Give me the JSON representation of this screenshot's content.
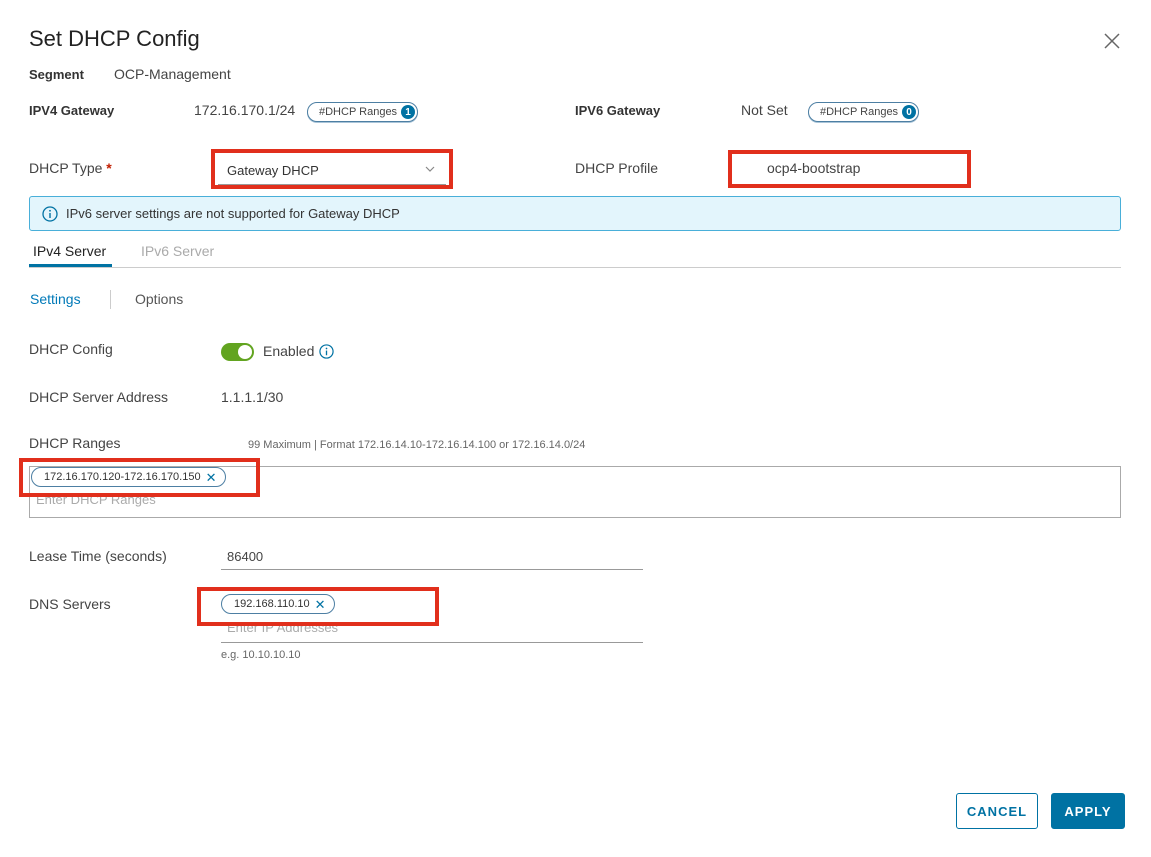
{
  "dialog": {
    "title": "Set DHCP Config"
  },
  "segment": {
    "label": "Segment",
    "value": "OCP-Management"
  },
  "ipv4_gateway": {
    "label": "IPV4 Gateway",
    "value": "172.16.170.1/24",
    "ranges_label": "#DHCP Ranges",
    "ranges_count": "1"
  },
  "ipv6_gateway": {
    "label": "IPV6 Gateway",
    "value": "Not Set",
    "ranges_label": "#DHCP Ranges",
    "ranges_count": "0"
  },
  "dhcp_type": {
    "label": "DHCP Type",
    "required_mark": "*",
    "value": "Gateway DHCP"
  },
  "dhcp_profile": {
    "label": "DHCP Profile",
    "value": "ocp4-bootstrap"
  },
  "alert": {
    "text": "IPv6 server settings are not supported for Gateway DHCP"
  },
  "tabs": [
    {
      "label": "IPv4 Server",
      "active": true
    },
    {
      "label": "IPv6 Server",
      "active": false
    }
  ],
  "subtabs": [
    {
      "label": "Settings",
      "active": true
    },
    {
      "label": "Options",
      "active": false
    }
  ],
  "dhcp_config": {
    "label": "DHCP Config",
    "toggle_state": "Enabled"
  },
  "server_address": {
    "label": "DHCP Server Address",
    "value": "1.1.1.1/30"
  },
  "dhcp_ranges": {
    "label": "DHCP Ranges",
    "hint": "99 Maximum | Format 172.16.14.10-172.16.14.100 or 172.16.14.0/24",
    "chips": [
      "172.16.170.120-172.16.170.150"
    ],
    "placeholder": "Enter DHCP Ranges"
  },
  "lease_time": {
    "label": "Lease Time (seconds)",
    "value": "86400"
  },
  "dns_servers": {
    "label": "DNS Servers",
    "chips": [
      "192.168.110.10"
    ],
    "placeholder": "Enter IP Addresses",
    "example": "e.g. 10.10.10.10"
  },
  "buttons": {
    "cancel": "CANCEL",
    "apply": "APPLY"
  },
  "colors": {
    "accent": "#0072a3",
    "highlight": "#e12f1c",
    "toggle_on": "#62a420",
    "alert_bg": "#e3f5fc"
  }
}
